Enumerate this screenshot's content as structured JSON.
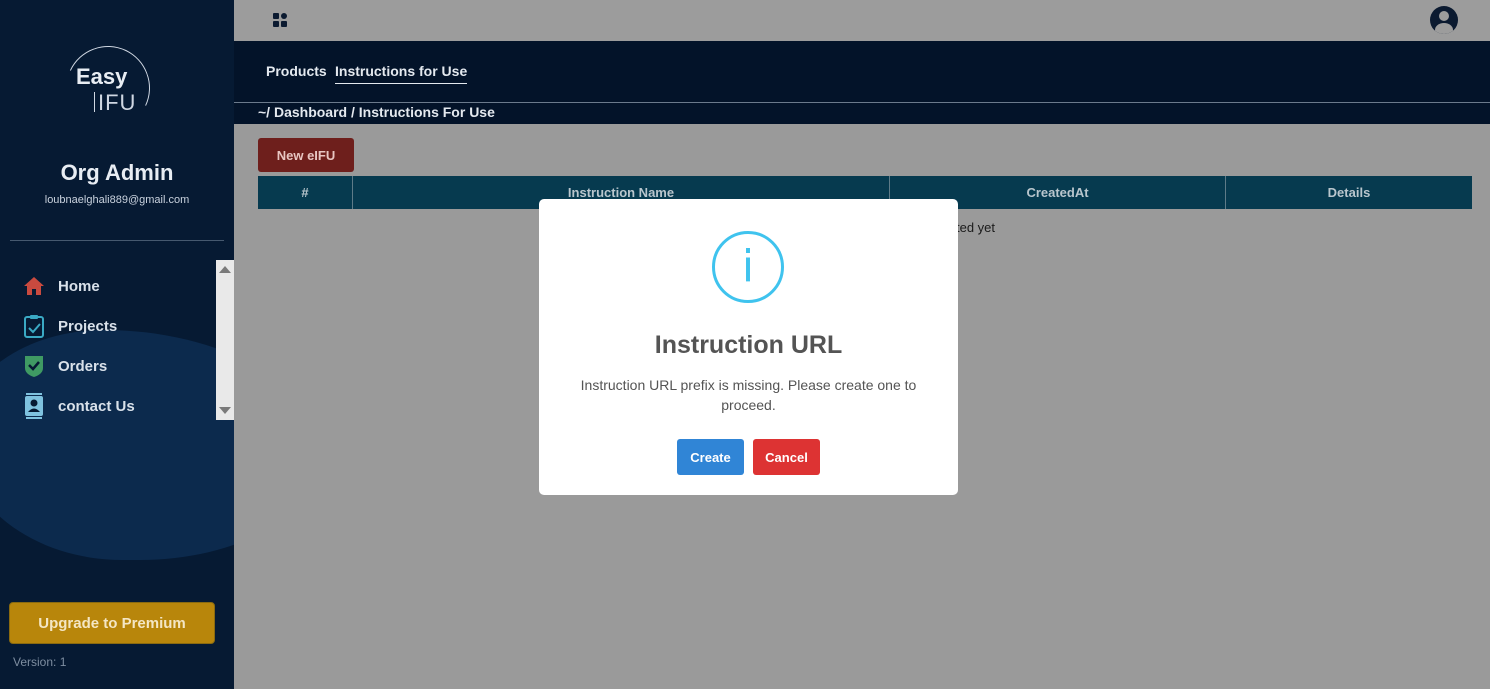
{
  "brand": {
    "line1": "Easy",
    "line2": "IFU"
  },
  "user": {
    "name": "Org Admin",
    "email": "loubnaelghali889@gmail.com"
  },
  "nav": [
    {
      "label": "Home",
      "icon": "home-icon",
      "color": "#c94a3f"
    },
    {
      "label": "Projects",
      "icon": "clipboard-check-icon",
      "color": "#3aa9c4"
    },
    {
      "label": "Orders",
      "icon": "shield-check-icon",
      "color": "#3f9a63"
    },
    {
      "label": "contact Us",
      "icon": "contact-card-icon",
      "color": "#7fc2df"
    }
  ],
  "upgrade_label": "Upgrade to Premium",
  "version": "Version: 1",
  "tabs": {
    "products": "Products",
    "ifu": "Instructions for Use"
  },
  "breadcrumb": "~/ Dashboard / Instructions For Use",
  "new_button": "New eIFU",
  "table": {
    "columns": [
      "#",
      "Instruction Name",
      "CreatedAt",
      "Details"
    ],
    "empty_fragment": "ted yet"
  },
  "modal": {
    "icon": "info-icon",
    "title": "Instruction URL",
    "message": "Instruction URL prefix is missing. Please create one to proceed.",
    "create": "Create",
    "cancel": "Cancel"
  }
}
